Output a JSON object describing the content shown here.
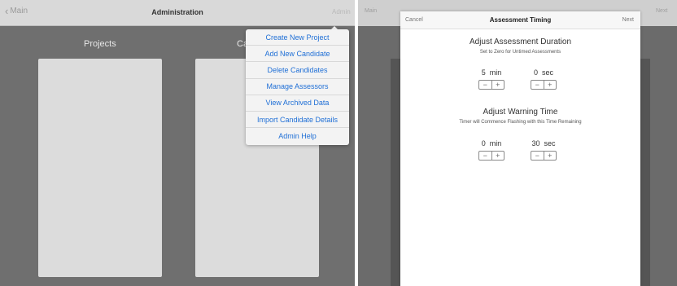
{
  "left": {
    "navbar": {
      "back_label": "Main",
      "title": "Administration",
      "admin_button": "Admin"
    },
    "columns": [
      "Projects",
      "Ca"
    ],
    "menu": [
      "Create New Project",
      "Add New Candidate",
      "Delete Candidates",
      "Manage Assessors",
      "View Archived Data",
      "Import Candidate Details",
      "Admin Help"
    ]
  },
  "right": {
    "background": {
      "left_label": "Main",
      "right_label": "Next"
    },
    "modal": {
      "cancel": "Cancel",
      "title": "Assessment Timing",
      "next": "Next",
      "duration": {
        "title": "Adjust Assessment Duration",
        "subtitle": "Set to Zero for Untimed Assessments",
        "min_value": "5",
        "min_unit": "min",
        "sec_value": "0",
        "sec_unit": "sec"
      },
      "warning": {
        "title": "Adjust Warning Time",
        "subtitle": "Timer will Commence Flashing with this Time Remaining",
        "min_value": "0",
        "min_unit": "min",
        "sec_value": "30",
        "sec_unit": "sec"
      },
      "stepper": {
        "minus": "−",
        "plus": "+"
      }
    }
  }
}
